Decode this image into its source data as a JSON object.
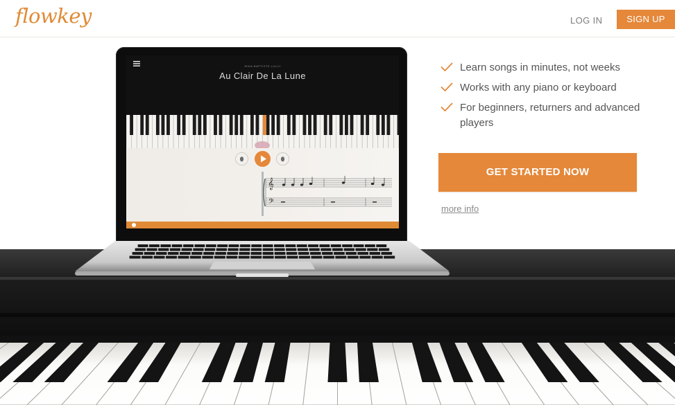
{
  "header": {
    "logo_text": "flowkey",
    "login_label": "LOG IN",
    "signup_label": "SIGN UP"
  },
  "laptop_app": {
    "composer": "JEAN-BAPTISTE LULLY",
    "song_title": "Au Clair De La Lune",
    "progress": 0.01
  },
  "features": [
    {
      "text": "Learn songs in minutes, not weeks",
      "icon": "check-icon"
    },
    {
      "text": "Works with any piano or keyboard",
      "icon": "check-icon"
    },
    {
      "text": "For beginners, returners and advanced players",
      "icon": "check-icon"
    }
  ],
  "cta_label": "GET STARTED NOW",
  "more_info_label": "more info",
  "colors": {
    "brand_orange": "#e5883a",
    "text_gray": "#555555",
    "link_gray": "#8a8a8a"
  }
}
